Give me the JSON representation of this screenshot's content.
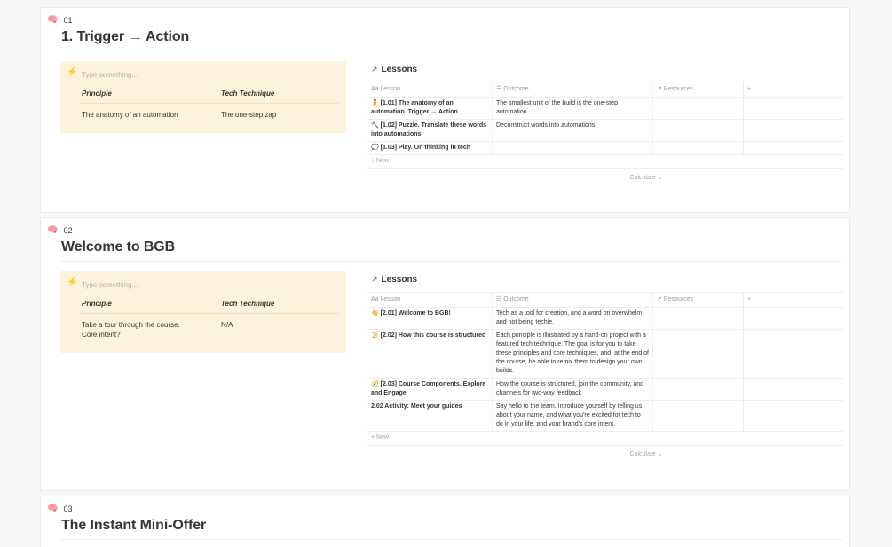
{
  "modules": [
    {
      "emoji": "🧠",
      "number": "01",
      "title": "1. Trigger → Action",
      "callout": {
        "icon": "⚡",
        "placeholder": "Type something...",
        "principle_header": "Principle",
        "technique_header": "Tech Technique",
        "principle": "The anatomy of an automation",
        "technique": "The one-step zap"
      },
      "db": {
        "arrow": "↗",
        "title": "Lessons",
        "columns": {
          "lesson": "Aa Lesson",
          "outcome": "☰ Outcome",
          "resources": "↗ Resources",
          "add": "+"
        },
        "rows": [
          {
            "emoji": "🧘",
            "lesson": "[1.01] The anatomy of an automation. Trigger → Action",
            "outcome": "The smallest unit of the build is the one-step automation"
          },
          {
            "emoji": "🔨",
            "lesson": "[1.02] Puzzle. Translate these words into automations",
            "outcome": "Deconstruct words into automations"
          },
          {
            "emoji": "💭",
            "lesson": "[1.03] Play. On thinking in tech",
            "outcome": ""
          }
        ],
        "new_label": "+ New",
        "calculate_label": "Calculate ⌄"
      }
    },
    {
      "emoji": "🧠",
      "number": "02",
      "title": "Welcome to BGB",
      "callout": {
        "icon": "⚡",
        "placeholder": "Type something...",
        "principle_header": "Principle",
        "technique_header": "Tech Technique",
        "principle": "Take a tour through the course. Core intent?",
        "technique": "N/A"
      },
      "db": {
        "arrow": "↗",
        "title": "Lessons",
        "columns": {
          "lesson": "Aa Lesson",
          "outcome": "☰ Outcome",
          "resources": "↗ Resources",
          "add": "+"
        },
        "rows": [
          {
            "emoji": "👋",
            "lesson": "[2.01] Welcome to BGB!",
            "outcome": "Tech as a tool for creation, and a word on overwhelm and not being techie."
          },
          {
            "emoji": "📜",
            "lesson": "[2.02] How this course is structured",
            "outcome": "Each principle is illustrated by a hand-on project with a featured tech technique. The goal is for you to take these principles and core techniques, and, at the end of the course, be able to remix them to design your own builds."
          },
          {
            "emoji": "🧭",
            "lesson": "[2.03] Course Components. Explore and Engage",
            "outcome": "How the course is structured, join the community, and channels for two-way feedback"
          },
          {
            "emoji": "",
            "lesson": "2.02 Activity: Meet your guides",
            "outcome": "Say hello to the team. Introduce yourself by telling us about your name, and what you're excited for tech to do in your life, and your brand's core intent."
          }
        ],
        "new_label": "+ New",
        "calculate_label": "Calculate ⌄"
      }
    },
    {
      "emoji": "🧠",
      "number": "03",
      "title": "The Instant Mini-Offer"
    }
  ]
}
